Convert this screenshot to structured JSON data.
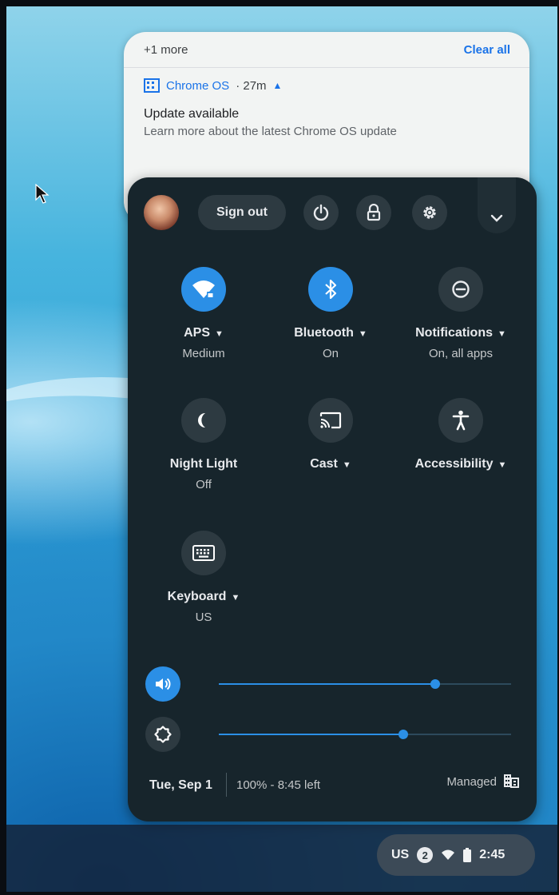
{
  "notification": {
    "more_label": "+1 more",
    "clear_all_label": "Clear all",
    "app_name": "Chrome OS",
    "time": "· 27m",
    "title": "Update available",
    "message": "Learn more about the latest Chrome OS update"
  },
  "quick_settings": {
    "sign_out_label": "Sign out",
    "top_buttons": [
      "power-icon",
      "lock-icon",
      "settings-icon",
      "collapse-chevron-icon"
    ],
    "tiles": [
      {
        "name": "wifi",
        "label": "APS",
        "sub": "Medium",
        "icon": "wifi-lock-icon",
        "active": true,
        "has_menu": true
      },
      {
        "name": "bluetooth",
        "label": "Bluetooth",
        "sub": "On",
        "icon": "bluetooth-icon",
        "active": true,
        "has_menu": true
      },
      {
        "name": "notifications",
        "label": "Notifications",
        "sub": "On, all apps",
        "icon": "do-not-disturb-icon",
        "active": false,
        "has_menu": true
      },
      {
        "name": "night-light",
        "label": "Night Light",
        "sub": "Off",
        "icon": "night-light-icon",
        "active": false,
        "has_menu": false
      },
      {
        "name": "cast",
        "label": "Cast",
        "sub": "",
        "icon": "cast-icon",
        "active": false,
        "has_menu": true
      },
      {
        "name": "accessibility",
        "label": "Accessibility",
        "sub": "",
        "icon": "accessibility-icon",
        "active": false,
        "has_menu": true
      },
      {
        "name": "keyboard",
        "label": "Keyboard",
        "sub": "US",
        "icon": "keyboard-icon",
        "active": false,
        "has_menu": true
      }
    ],
    "volume_level": 0.74,
    "brightness_level": 0.63,
    "date": "Tue, Sep 1",
    "battery": "100% - 8:45 left",
    "managed_label": "Managed"
  },
  "shelf": {
    "ime": "US",
    "notification_count": "2",
    "time": "2:45"
  },
  "colors": {
    "accent": "#2b8fe6",
    "panel": "#17252c",
    "link": "#1a73e8"
  }
}
